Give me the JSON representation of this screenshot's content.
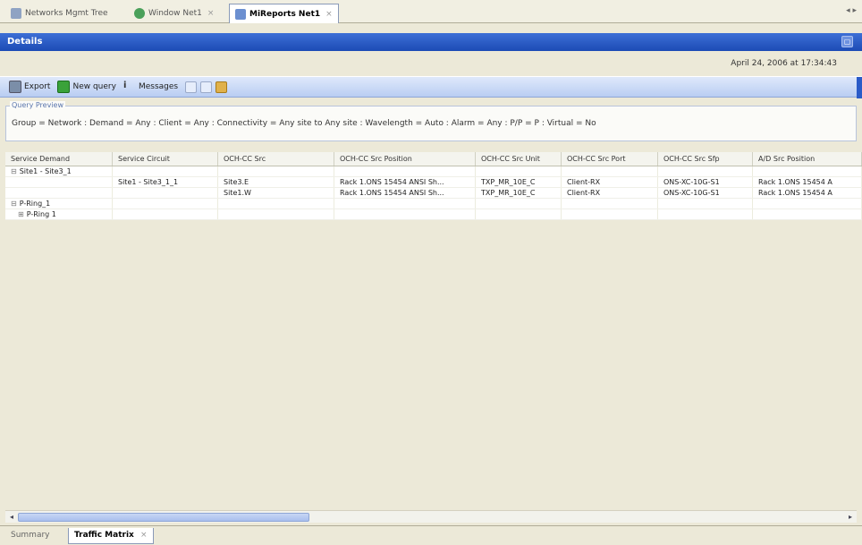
{
  "editor_tabs": [
    {
      "label": "Networks Mgmt Tree"
    },
    {
      "label": "Window Net1"
    },
    {
      "label": "MiReports Net1",
      "active": true
    }
  ],
  "title": "Details",
  "date": "April 24, 2006 at 17:34:43",
  "toolbar": {
    "export_label": "Export",
    "newquery_label": "New query",
    "messages_label": "Messages"
  },
  "query_preview": {
    "legend": "Query Preview",
    "text": "Group = Network : Demand = Any : Client = Any : Connectivity = Any site to Any site : Wavelength = Auto : Alarm = Any : P/P = P : Virtual = No"
  },
  "columns": [
    "Service Demand",
    "Service Circuit",
    "OCH-CC Src",
    "OCH-CC Src Position",
    "OCH-CC Src Unit",
    "OCH-CC Src Port",
    "OCH-CC Src Sfp",
    "A/D Src Position"
  ],
  "rows": [
    {
      "toggle": "⊟",
      "cells": [
        "Site1 - Site3_1",
        "",
        "",
        "",
        "",
        "",
        "",
        ""
      ]
    },
    {
      "toggle": "",
      "cells": [
        "",
        "Site1 - Site3_1_1",
        "Site3.E",
        "Rack 1.ONS 15454 ANSI Sh...",
        "TXP_MR_10E_C",
        "Client-RX",
        "ONS-XC-10G-S1",
        "Rack 1.ONS 15454 A"
      ]
    },
    {
      "toggle": "",
      "cells": [
        "",
        "",
        "Site1.W",
        "Rack 1.ONS 15454 ANSI Sh...",
        "TXP_MR_10E_C",
        "Client-RX",
        "ONS-XC-10G-S1",
        "Rack 1.ONS 15454 A"
      ]
    },
    {
      "toggle": "⊟",
      "cells": [
        "P-Ring_1",
        "",
        "",
        "",
        "",
        "",
        "",
        ""
      ]
    },
    {
      "toggle": "⊞",
      "cells": [
        "P-Ring 1",
        "",
        "",
        "",
        "",
        "",
        "",
        ""
      ]
    }
  ],
  "bottom_tabs": [
    {
      "label": "Summary"
    },
    {
      "label": "Traffic Matrix",
      "active": true
    }
  ],
  "colors": {
    "titlebar": "#1c4bb5",
    "toolbar": "#b9cdf2"
  }
}
